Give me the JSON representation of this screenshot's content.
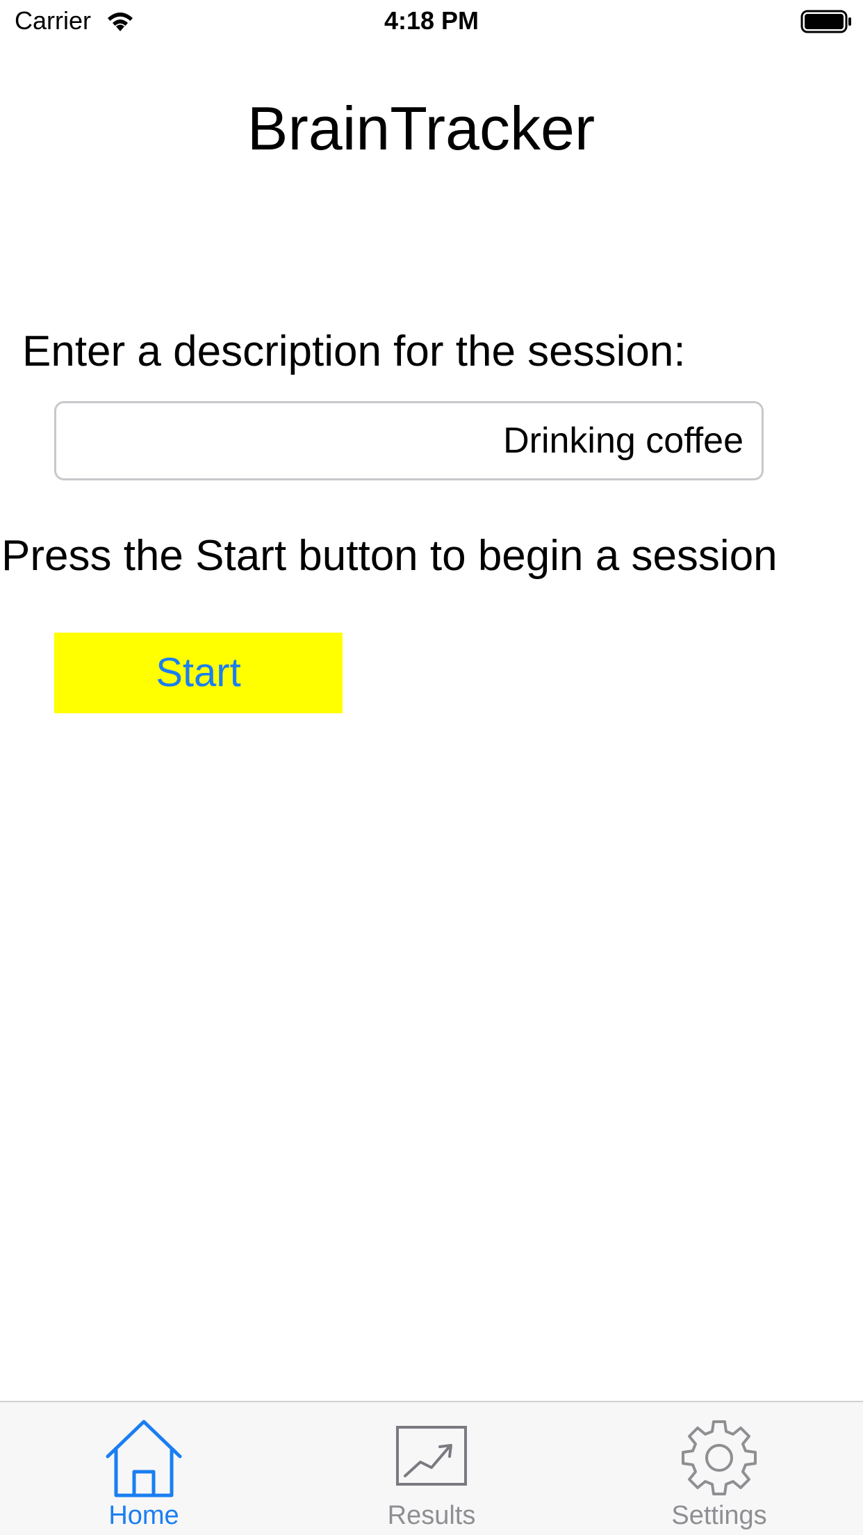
{
  "status_bar": {
    "carrier": "Carrier",
    "time": "4:18 PM",
    "icons": [
      "wifi-icon",
      "battery-icon"
    ]
  },
  "app": {
    "title": "BrainTracker"
  },
  "session": {
    "description_label": "Enter a description for the session:",
    "description_value": "Drinking coffee",
    "instruction": "Press the Start button to begin a session",
    "start_label": "Start"
  },
  "tab_bar": {
    "tabs": [
      {
        "label": "Home",
        "icon": "home-icon",
        "active": true
      },
      {
        "label": "Results",
        "icon": "chart-icon",
        "active": false
      },
      {
        "label": "Settings",
        "icon": "gear-icon",
        "active": false
      }
    ]
  },
  "colors": {
    "accent": "#1a7ef2",
    "button_bg": "#ffff00",
    "inactive": "#8e8e93"
  }
}
